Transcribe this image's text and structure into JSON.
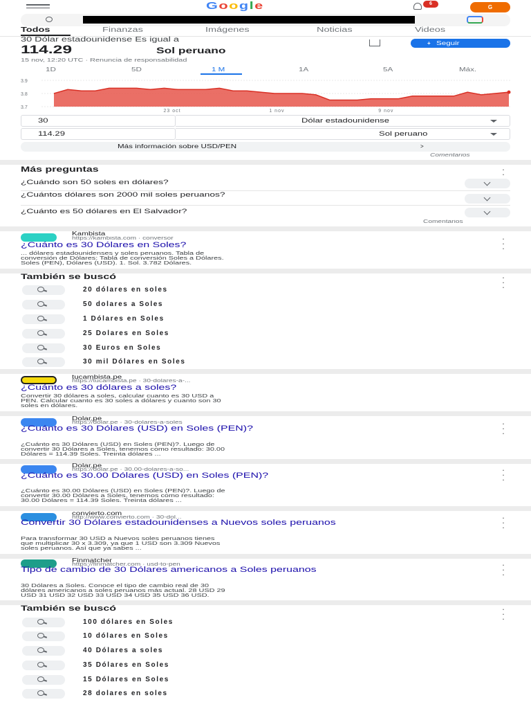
{
  "header": {
    "logo": "Google",
    "notif_count": "6",
    "avatar_letter": "G"
  },
  "tabs": [
    {
      "label": "Todos",
      "active": true
    },
    {
      "label": "Finanzas"
    },
    {
      "label": "Imágenes"
    },
    {
      "label": "Noticias"
    },
    {
      "label": "Videos"
    }
  ],
  "converter": {
    "subtitle": "30 Dólar estadounidense Es igual a",
    "value": "114.29",
    "currency": "Sol peruano",
    "follow": "Seguir",
    "timestamp": "15 nov, 12:20 UTC · Renuncia de responsabilidad",
    "ranges": [
      "1D",
      "5D",
      "1 M",
      "1A",
      "5A",
      "Máx."
    ],
    "active_range": "1 M",
    "ylabels": [
      "3.9",
      "3.8",
      "3.7"
    ],
    "xlabels": [
      "23 oct",
      "1 nov",
      "9 nov"
    ],
    "from_amount": "30",
    "from_currency": "Dólar estadounidense",
    "to_amount": "114.29",
    "to_currency": "Sol peruano",
    "more_info": "Más información sobre USD/PEN",
    "feedback": "Comentarios"
  },
  "chart_data": {
    "type": "area",
    "title": "",
    "xlabel": "",
    "ylabel": "",
    "ylim": [
      3.7,
      3.9
    ],
    "x_ticks": [
      "23 oct",
      "1 nov",
      "9 nov"
    ],
    "values": [
      3.8,
      3.83,
      3.82,
      3.82,
      3.84,
      3.84,
      3.84,
      3.83,
      3.84,
      3.83,
      3.83,
      3.83,
      3.84,
      3.82,
      3.82,
      3.81,
      3.8,
      3.8,
      3.8,
      3.79,
      3.75,
      3.75,
      3.75,
      3.76,
      3.76,
      3.76,
      3.78,
      3.78,
      3.78,
      3.78,
      3.81,
      3.79,
      3.8,
      3.81
    ],
    "color": "#d93025"
  },
  "paa": {
    "title": "Más preguntas",
    "questions": [
      "¿Cuándo son 50 soles en dólares?",
      "¿Cuántos dólares son 2000 mil soles peruanos?",
      "¿Cuánto es 50 dólares en El Salvador?"
    ],
    "feedback": "Comentarios"
  },
  "result1": {
    "site": "Kambista",
    "url": "https://kambista.com · conversor",
    "title": "¿Cuánto es 30 Dólares en Soles?",
    "snippet": [
      "... dólares estadounidenses y soles peruanos. Tabla de",
      "conversión de Dólares: Tabla de conversión Soles a Dólares.",
      "Soles (PEN), Dólares (USD). 1. Sol. 3.782 Dólares."
    ]
  },
  "related1": {
    "title": "También se buscó",
    "items": [
      "20 dólares en soles",
      "50 dolares a Soles",
      "1 Dólares en Soles",
      "25 Dolares en Soles",
      "30 Euros en Soles",
      "30 mil Dólares en Soles"
    ]
  },
  "result2": {
    "site": "tucambista.pe",
    "url": "https://tucambista.pe · 30-dolares-a-...",
    "title": "¿Cuánto es 30 dólares a soles?",
    "snippet": [
      "Convertir 30 dólares a soles, calcular cuanto es 30 USD a",
      "PEN. Calcular cuanto es 30 soles a dólares y cuanto son 30",
      "soles en dólares."
    ]
  },
  "result3": {
    "site": "Dolar.pe",
    "url": "https://dolar.pe · 30-dolares-a-soles",
    "title": "¿Cuánto es 30 Dólares (USD) en Soles (PEN)?",
    "snippet": [
      "¿Cuánto es 30 Dólares (USD) en Soles (PEN)?. Luego de",
      "convertir 30 Dólares a Soles, tenemos como resultado: 30.00",
      "Dólares = 114.39 Soles. Treinta dólares ..."
    ]
  },
  "result4": {
    "site": "Dolar.pe",
    "url": "https://dolar.pe · 30.00-dolares-a-so...",
    "title": "¿Cuánto es 30.00 Dólares (USD) en Soles (PEN)?",
    "snippet": [
      "¿Cuánto es 30.00 Dólares (USD) en Soles (PEN)?. Luego de",
      "convertir 30.00 Dólares a Soles, tenemos como resultado:",
      "30.00 Dólares = 114.39 Soles. Treinta dólares ..."
    ]
  },
  "result5": {
    "site": "convierto.com",
    "url": "http://www.convierto.com · 30-dol...",
    "title": "Convertir 30 Dólares estadounidenses a Nuevos soles peruanos",
    "snippet": [
      "Para transformar 30 USD a Nuevos soles peruanos tienes",
      "que multiplicar 30 x 3.309, ya que 1 USD son 3.309 Nuevos",
      "soles peruanos. Así que ya sabes ..."
    ]
  },
  "result6": {
    "site": "Finmatcher",
    "url": "https://finmatcher.com · usd-to-pen",
    "title": "Tipo de cambio de 30 Dólares americanos a Soles peruanos",
    "snippet": [
      "30 Dólares a Soles. Conoce el tipo de cambio real de 30",
      "dólares americanos a soles peruanos más actual. 28 USD 29",
      "USD 31 USD 32 USD 33 USD 34 USD 35 USD 36 USD."
    ]
  },
  "related2": {
    "title": "También se buscó",
    "items": [
      "100 dólares en Soles",
      "10 dólares en Soles",
      "40 Dólares a soles",
      "35 Dólares en Soles",
      "15 Dólares en Soles",
      "28 dolares en soles"
    ]
  }
}
